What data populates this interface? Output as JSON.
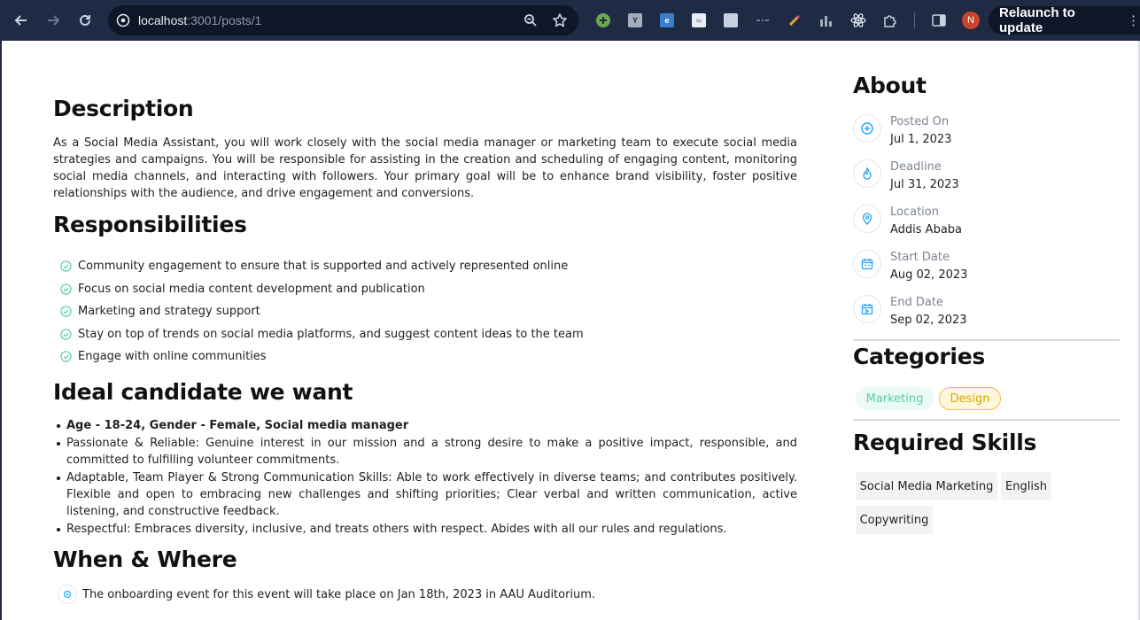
{
  "browser": {
    "url_host": "localhost",
    "url_path": ":3001/posts/1",
    "relaunch_label": "Relaunch to update",
    "profile_initial": "N",
    "colors": {
      "toolbar": "#1f2a44",
      "omnibox": "#0e1628",
      "avatar": "#c8462d"
    }
  },
  "description": {
    "heading": "Description",
    "text": "As a Social Media Assistant, you will work closely with the social media manager or marketing team to execute social media strategies and campaigns. You will be responsible for assisting in the creation and scheduling of engaging content, monitoring social media channels, and interacting with followers. Your primary goal will be to enhance brand visibility, foster positive relationships with the audience, and drive engagement and conversions."
  },
  "responsibilities": {
    "heading": "Responsibilities",
    "items": [
      "Community engagement to ensure that is supported and actively represented online",
      "Focus on social media content development and publication",
      "Marketing and strategy support",
      "Stay on top of trends on social media platforms, and suggest content ideas to the team",
      "Engage with online communities"
    ]
  },
  "ideal_candidate": {
    "heading": "Ideal candidate we want",
    "items": [
      "Age - 18-24, Gender - Female, Social media manager",
      "Passionate & Reliable: Genuine interest in our mission and a strong desire to make a positive impact, responsible, and committed to fulfilling volunteer commitments.",
      "Adaptable, Team Player & Strong Communication Skills: Able to work effectively in diverse teams; and contributes positively. Flexible and open to embracing new challenges and shifting priorities; Clear verbal and written communication, active listening, and constructive feedback.",
      "Respectful: Embraces diversity, inclusive, and treats others with respect. Abides with all our rules and regulations."
    ]
  },
  "when_where": {
    "heading": "When & Where",
    "text": "The onboarding event for this event will take place on Jan 18th, 2023 in AAU Auditorium."
  },
  "about": {
    "heading": "About",
    "items": [
      {
        "label": "Posted On",
        "value": "Jul 1, 2023",
        "icon": "plus-circle-icon"
      },
      {
        "label": "Deadline",
        "value": "Jul 31, 2023",
        "icon": "fire-icon"
      },
      {
        "label": "Location",
        "value": "Addis Ababa",
        "icon": "location-pin-icon"
      },
      {
        "label": "Start Date",
        "value": "Aug 02, 2023",
        "icon": "calendar-icon"
      },
      {
        "label": "End Date",
        "value": "Sep 02, 2023",
        "icon": "calendar-check-icon"
      }
    ]
  },
  "categories": {
    "heading": "Categories",
    "items": [
      {
        "label": "Marketing",
        "text_color": "#56cdad",
        "bg_color": "#ebfaf4",
        "border_color": "#ebfaf4"
      },
      {
        "label": "Design",
        "text_color": "#d4a500",
        "bg_color": "#fff8dc",
        "border_color": "#ffb836"
      }
    ]
  },
  "skills": {
    "heading": "Required Skills",
    "items": [
      "Social Media Marketing",
      "English",
      "Copywriting"
    ]
  },
  "accent_color": "#26a4ff",
  "check_color": "#56cdad"
}
